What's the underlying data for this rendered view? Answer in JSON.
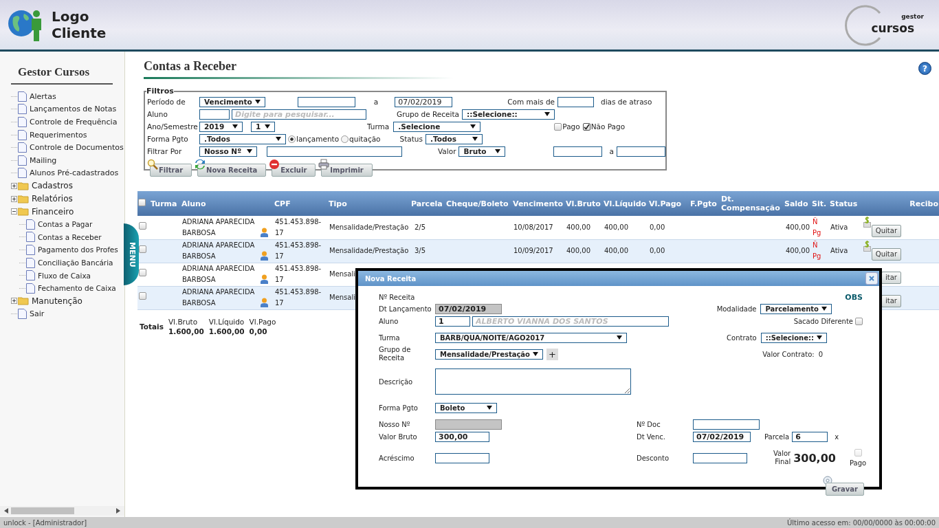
{
  "header": {
    "logo_line1": "Logo",
    "logo_line2": "Cliente",
    "brand_small": "gestor",
    "brand": "cursos"
  },
  "sidebar": {
    "title": "Gestor Cursos",
    "items": [
      {
        "label": "Alertas",
        "kind": "page"
      },
      {
        "label": "Lançamentos de Notas",
        "kind": "page"
      },
      {
        "label": "Controle de Frequência",
        "kind": "page"
      },
      {
        "label": "Requerimentos",
        "kind": "page"
      },
      {
        "label": "Controle de Documentos",
        "kind": "page"
      },
      {
        "label": "Mailing",
        "kind": "page"
      },
      {
        "label": "Alunos Pré-cadastrados",
        "kind": "page"
      },
      {
        "label": "Cadastros",
        "kind": "folder",
        "expanded": false
      },
      {
        "label": "Relatórios",
        "kind": "folder",
        "expanded": false
      },
      {
        "label": "Financeiro",
        "kind": "folder",
        "expanded": true,
        "children": [
          {
            "label": "Contas a Pagar",
            "kind": "page"
          },
          {
            "label": "Contas a Receber",
            "kind": "page"
          },
          {
            "label": "Pagamento dos Profes",
            "kind": "page"
          },
          {
            "label": "Conciliação Bancária",
            "kind": "page"
          },
          {
            "label": "Fluxo de Caixa",
            "kind": "page"
          },
          {
            "label": "Fechamento de Caixa",
            "kind": "page"
          }
        ]
      },
      {
        "label": "Manutenção",
        "kind": "folder",
        "expanded": false
      },
      {
        "label": "Sair",
        "kind": "page"
      }
    ]
  },
  "menu_tab": "MENU",
  "page_title": "Contas a Receber",
  "help": "?",
  "filters": {
    "legend": "Filtros",
    "periodo": {
      "label": "Período de",
      "select": "Vencimento",
      "to_label": "a",
      "to": "07/02/2019"
    },
    "atraso": {
      "label": "Com mais de",
      "suffix": "dias de atraso"
    },
    "aluno": {
      "label": "Aluno",
      "placeholder": "Digite para pesquisar..."
    },
    "grupo": {
      "label": "Grupo de Receita",
      "select": "::Selecione::"
    },
    "ano": {
      "label": "Ano/Semestre",
      "year": "2019",
      "semester": "1"
    },
    "turma": {
      "label": "Turma",
      "select": ".Selecione"
    },
    "pago": {
      "label": "Pago",
      "checked": false
    },
    "nao_pago": {
      "label": "Não Pago",
      "checked": true
    },
    "forma": {
      "label": "Forma Pgto",
      "select": ".Todos",
      "options": [
        {
          "label": "lançamento",
          "selected": true
        },
        {
          "label": "quitação",
          "selected": false
        }
      ]
    },
    "status": {
      "label": "Status",
      "select": ".Todos"
    },
    "filtrar_por": {
      "label": "Filtrar Por",
      "select": "Nosso Nº"
    },
    "valor": {
      "label": "Valor",
      "select": "Bruto",
      "to_label": "a"
    },
    "buttons": [
      {
        "label": "Filtrar",
        "kind": "search"
      },
      {
        "label": "Nova Receita",
        "kind": "new"
      },
      {
        "label": "Excluir",
        "kind": "delete"
      },
      {
        "label": "Imprimir",
        "kind": "print"
      }
    ]
  },
  "table": {
    "columns": [
      "Turma",
      "Aluno",
      "CPF",
      "Tipo",
      "Parcela",
      "Cheque/Boleto",
      "Vencimento",
      "Vl.Bruto",
      "Vl.Líquido",
      "Vl.Pago",
      "F.Pgto",
      "Dt. Compensação",
      "Saldo",
      "Sit.",
      "Status",
      "Recibo"
    ],
    "select_all_checked": false,
    "rows": [
      {
        "checked": false,
        "aluno": "ADRIANA APARECIDA BARBOSA",
        "cpf": "451.453.898-17",
        "tipo": "Mensalidade/Prestação",
        "parcela": "2/5",
        "vencimento": "10/08/2017",
        "bruto": "400,00",
        "liquido": "400,00",
        "pago": "0,00",
        "saldo": "400,00",
        "sit": "Ñ Pg",
        "status": "Ativa",
        "action": "Quitar"
      },
      {
        "checked": false,
        "aluno": "ADRIANA APARECIDA BARBOSA",
        "cpf": "451.453.898-17",
        "tipo": "Mensalidade/Prestação",
        "parcela": "3/5",
        "vencimento": "10/09/2017",
        "bruto": "400,00",
        "liquido": "400,00",
        "pago": "0,00",
        "saldo": "400,00",
        "sit": "Ñ Pg",
        "status": "Ativa",
        "action": "Quitar"
      },
      {
        "checked": false,
        "aluno": "ADRIANA APARECIDA BARBOSA",
        "cpf": "451.453.898-17",
        "tipo": "Mensali",
        "action": "itar"
      },
      {
        "checked": false,
        "aluno": "ADRIANA APARECIDA BARBOSA",
        "cpf": "451.453.898-17",
        "tipo": "Mensali",
        "action": "itar"
      }
    ]
  },
  "totals": {
    "label": "Totais",
    "items": [
      {
        "label": "Vl.Bruto",
        "value": "1.600,00"
      },
      {
        "label": "Vl.Líquido",
        "value": "1.600,00"
      },
      {
        "label": "Vl.Pago",
        "value": "0,00"
      }
    ]
  },
  "dialog": {
    "title": "Nova Receita",
    "numero": "Nº Receita",
    "obs": "OBS",
    "dt_lancamento": {
      "label": "Dt Lançamento",
      "value": "07/02/2019",
      "disabled": true
    },
    "modalidade": {
      "label": "Modalidade",
      "select": "Parcelamento"
    },
    "aluno": {
      "label": "Aluno",
      "code": "1",
      "name": "ALBERTO VIANNA DOS SANTOS"
    },
    "sacado": {
      "label": "Sacado Diferente",
      "checked": false
    },
    "turma": {
      "label": "Turma",
      "select": "BARB/QUA/NOITE/AGO2017"
    },
    "contrato": {
      "label": "Contrato",
      "select": "::Selecione::"
    },
    "grupo": {
      "label": "Grupo de Receita",
      "select": "Mensalidade/Prestação",
      "add": "+"
    },
    "valor_contrato": {
      "label": "Valor Contrato:",
      "value": "0"
    },
    "descricao": {
      "label": "Descrição"
    },
    "forma": {
      "label": "Forma Pgto",
      "select": "Boleto"
    },
    "nosso": {
      "label": "Nosso Nº",
      "disabled": true
    },
    "doc": {
      "label": "Nº Doc"
    },
    "bruto": {
      "label": "Valor Bruto",
      "value": "300,00"
    },
    "venc": {
      "label": "Dt Venc.",
      "value": "07/02/2019"
    },
    "parcela": {
      "label": "Parcela",
      "value": "6",
      "suffix": "x"
    },
    "acrescimo": {
      "label": "Acréscimo"
    },
    "desconto": {
      "label": "Desconto"
    },
    "final": {
      "label": "Valor Final",
      "value": "300,00"
    },
    "pago": {
      "label": "Pago",
      "checked": false,
      "disabled": true
    },
    "button": "Gravar"
  },
  "status_bar": {
    "user": "unlock - [Administrador]",
    "last_access": "Último acesso em: 00/00/0000  às 00:00:00"
  }
}
